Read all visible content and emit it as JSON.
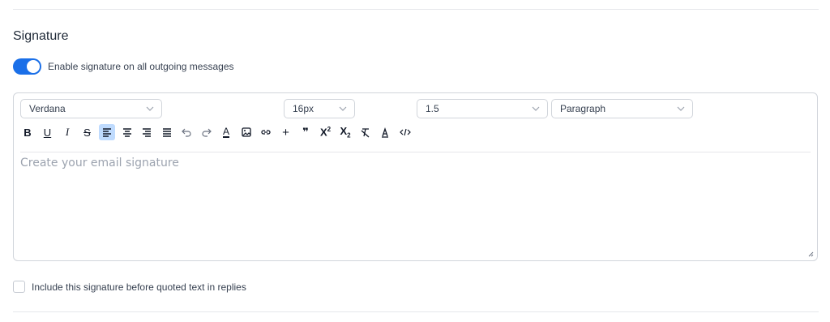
{
  "section": {
    "title": "Signature"
  },
  "toggle": {
    "label": "Enable signature on all outgoing messages",
    "checked": true,
    "color": "#1a6fe8"
  },
  "editor": {
    "font_family": "Verdana",
    "font_size": "16px",
    "line_height": "1.5",
    "block_format": "Paragraph",
    "placeholder": "Create your email signature",
    "toolbar": [
      {
        "name": "bold-icon",
        "glyph": "B"
      },
      {
        "name": "underline-icon",
        "glyph": "U"
      },
      {
        "name": "italic-icon",
        "glyph": "I"
      },
      {
        "name": "strikethrough-icon",
        "glyph": "S"
      },
      {
        "name": "align-left-icon",
        "active": true
      },
      {
        "name": "align-center-icon"
      },
      {
        "name": "align-right-icon"
      },
      {
        "name": "align-justify-icon"
      },
      {
        "name": "undo-icon"
      },
      {
        "name": "redo-icon"
      },
      {
        "name": "text-color-icon",
        "glyph": "A"
      },
      {
        "name": "image-icon"
      },
      {
        "name": "link-icon"
      },
      {
        "name": "insert-icon",
        "glyph": "+"
      },
      {
        "name": "blockquote-icon",
        "glyph": "❞"
      },
      {
        "name": "superscript-icon"
      },
      {
        "name": "subscript-icon"
      },
      {
        "name": "clear-format-icon"
      },
      {
        "name": "format-painter-icon"
      },
      {
        "name": "code-view-icon"
      }
    ]
  },
  "include_option": {
    "label": "Include this signature before quoted text in replies",
    "checked": false
  }
}
